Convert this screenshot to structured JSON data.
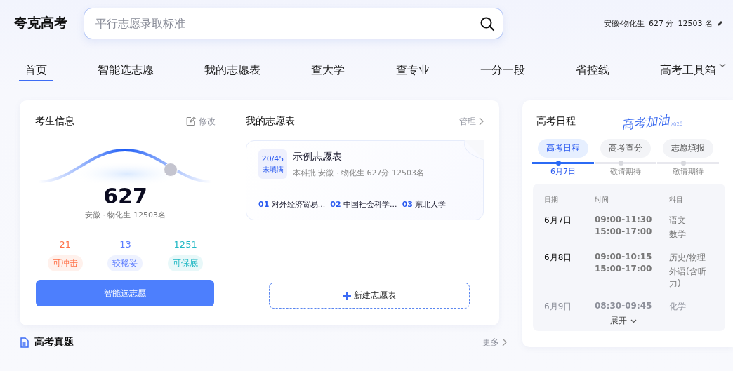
{
  "logo": "夸克高考",
  "search": {
    "placeholder": "平行志愿录取标准"
  },
  "user_info": {
    "region": "安徽·物化生",
    "score": "627 分",
    "rank": "12503 名"
  },
  "nav": [
    {
      "label": "首页",
      "selected": true
    },
    {
      "label": "智能选志愿",
      "selected": false
    },
    {
      "label": "我的志愿表",
      "selected": false
    },
    {
      "label": "查大学",
      "selected": false
    },
    {
      "label": "查专业",
      "selected": false
    },
    {
      "label": "一分一段",
      "selected": false
    },
    {
      "label": "省控线",
      "selected": false
    },
    {
      "label": "高考工具箱",
      "selected": false,
      "dropdown": true
    }
  ],
  "student_info": {
    "title": "考生信息",
    "edit": "修改",
    "score": "627",
    "detail": "安徽 · 物化生 12503名",
    "stats": [
      {
        "count": "21",
        "label": "可冲击",
        "color": "#ff7148"
      },
      {
        "count": "13",
        "label": "较稳妥",
        "color": "#5b7cff"
      },
      {
        "count": "1251",
        "label": "可保底",
        "color": "#22b8c4"
      }
    ],
    "button": "智能选志愿"
  },
  "my_lists": {
    "title": "我的志愿表",
    "manage": "管理",
    "card": {
      "progress": "20/45",
      "status": "未填满",
      "name": "示例志愿表",
      "meta": "本科批 安徽 · 物化生 627分 12503名",
      "schools": [
        {
          "no": "01",
          "name": "对外经济贸易..."
        },
        {
          "no": "02",
          "name": "中国社会科学..."
        },
        {
          "no": "03",
          "name": "东北大学"
        }
      ]
    },
    "new_button": "新建志愿表"
  },
  "schedule": {
    "title": "高考日程",
    "badge": "高考加油",
    "badge_year": "2025",
    "tabs": [
      {
        "label": "高考日程",
        "date": "6月7日",
        "selected": true
      },
      {
        "label": "高考查分",
        "date": "敬请期待",
        "selected": false
      },
      {
        "label": "志愿填报",
        "date": "敬请期待",
        "selected": false
      }
    ],
    "columns": [
      "日期",
      "时间",
      "科目"
    ],
    "rows": [
      {
        "date": "6月7日",
        "times": [
          "09:00-11:30",
          "15:00-17:00"
        ],
        "subjects": [
          "语文",
          "数学"
        ]
      },
      {
        "date": "6月8日",
        "times": [
          "09:00-10:15",
          "15:00-17:00"
        ],
        "subjects": [
          "历史/物理",
          "外语(含听力)"
        ]
      },
      {
        "date": "6月9日",
        "times": [
          "08:30-09:45"
        ],
        "subjects": [
          "化学"
        ]
      }
    ],
    "expand": "展开"
  },
  "exam_papers": {
    "title": "高考真题",
    "more": "更多"
  }
}
